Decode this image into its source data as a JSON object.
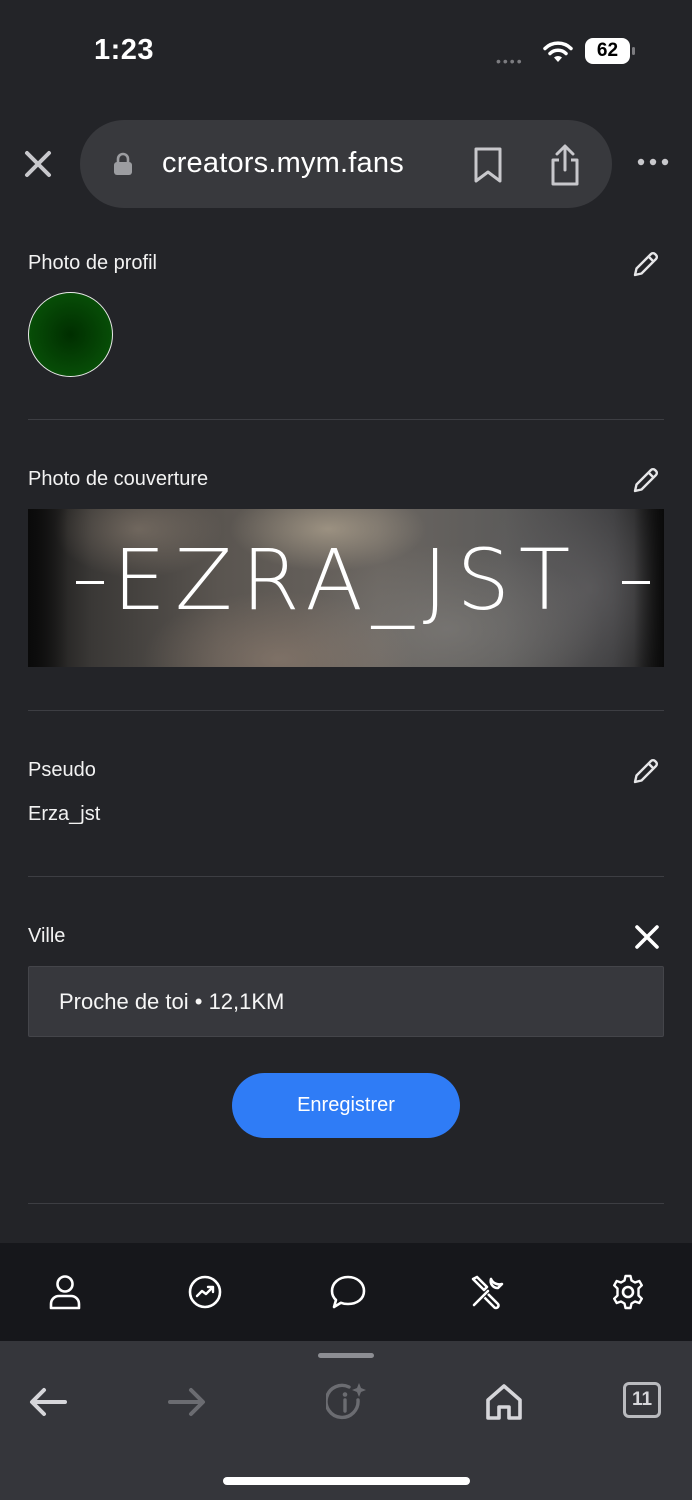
{
  "status_bar": {
    "time": "1:23",
    "battery": "62"
  },
  "browser": {
    "url": "creators.mym.fans"
  },
  "profile": {
    "photo_label": "Photo de profil",
    "cover_label": "Photo de couverture",
    "cover_text": "EZRA_JST",
    "pseudo_label": "Pseudo",
    "pseudo_value": "Erza_jst",
    "city_label": "Ville",
    "city_value": "Proche de toi • 12,1KM",
    "save_label": "Enregistrer"
  },
  "app_nav": {
    "items": [
      "profile-icon",
      "stats-icon",
      "messages-icon",
      "tools-icon",
      "settings-icon"
    ]
  },
  "browser_toolbar": {
    "tabs_count": "11"
  },
  "colors": {
    "accent": "#2f7cf6",
    "background": "#232428",
    "avatar": "#004d00"
  }
}
